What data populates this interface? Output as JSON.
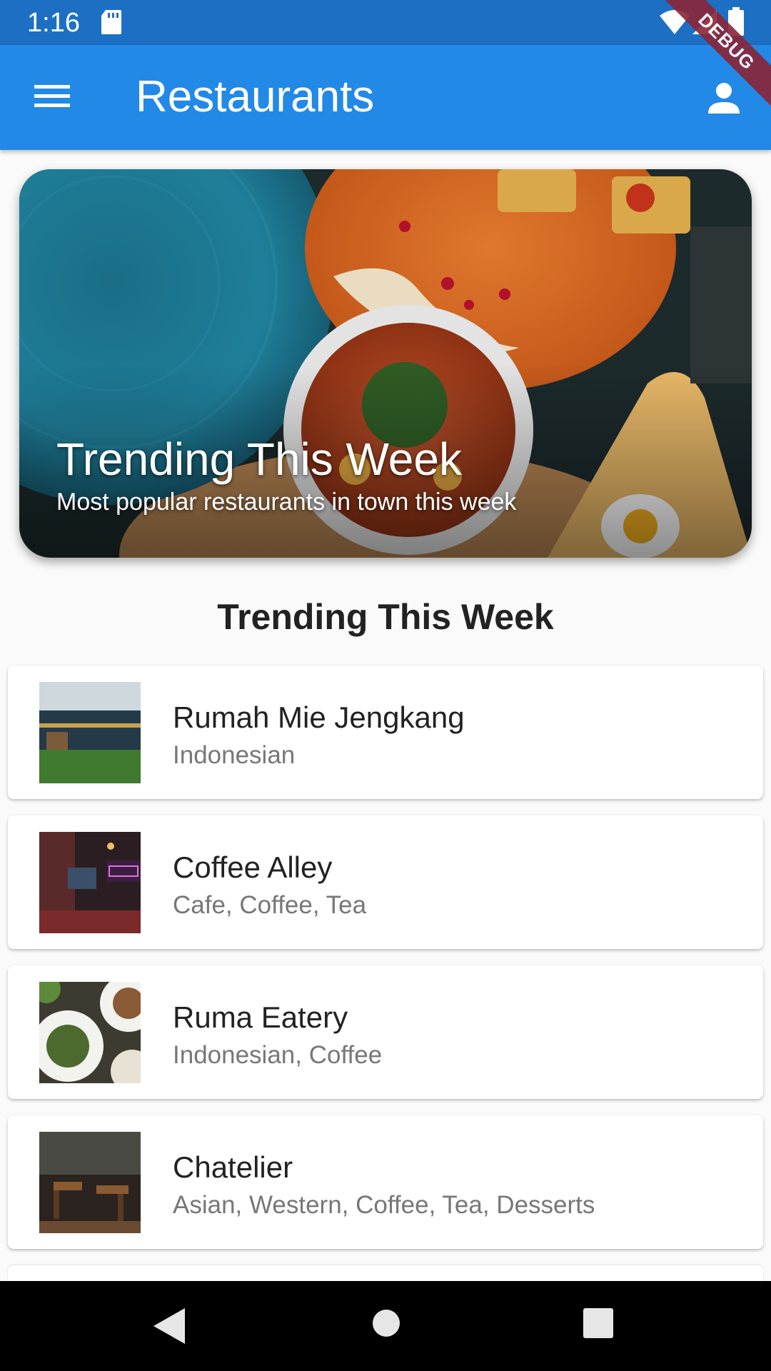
{
  "status_bar": {
    "time": "1:16",
    "icons": [
      "sd-card-icon",
      "wifi-icon",
      "signal-icon",
      "battery-icon"
    ]
  },
  "app_bar": {
    "title": "Restaurants",
    "menu_icon": "menu-icon",
    "account_icon": "account-icon",
    "color": "#2289e6"
  },
  "debug_banner": "DEBUG",
  "hero": {
    "title": "Trending This Week",
    "subtitle": "Most popular restaurants in town this week"
  },
  "section": {
    "title": "Trending This Week"
  },
  "restaurants": [
    {
      "name": "Rumah Mie Jengkang",
      "cuisine": "Indonesian"
    },
    {
      "name": "Coffee Alley",
      "cuisine": "Cafe, Coffee, Tea"
    },
    {
      "name": "Ruma Eatery",
      "cuisine": "Indonesian, Coffee"
    },
    {
      "name": "Chatelier",
      "cuisine": "Asian, Western, Coffee, Tea, Desserts"
    }
  ],
  "nav_bar": {
    "buttons": [
      "back-icon",
      "home-icon",
      "recents-icon"
    ]
  }
}
